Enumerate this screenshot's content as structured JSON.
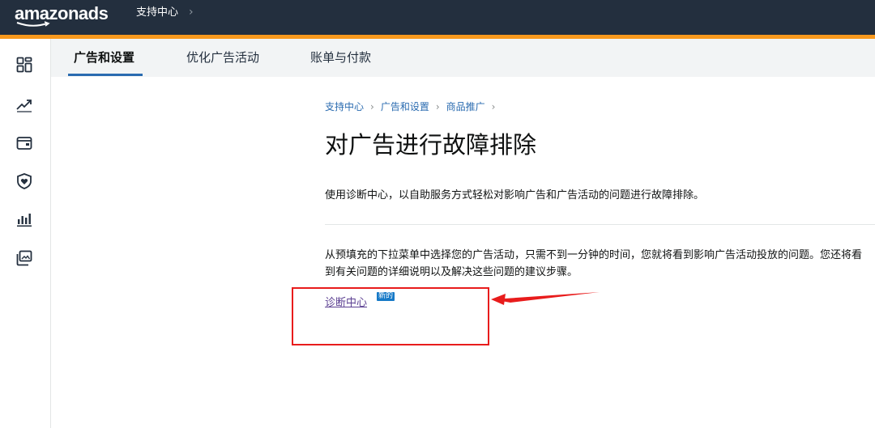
{
  "topbar": {
    "logo": "amazonads",
    "breadcrumb": "支持中心",
    "chevron": "›",
    "accent_color": "#f8991d",
    "background_color": "#232f3e"
  },
  "rail": {
    "icons": [
      "dashboard-icon",
      "trend-icon",
      "wallet-icon",
      "shield-heart-icon",
      "bar-chart-icon",
      "gallery-icon"
    ]
  },
  "tabs": [
    {
      "label": "广告和设置",
      "active": true
    },
    {
      "label": "优化广告活动",
      "active": false
    },
    {
      "label": "账单与付款",
      "active": false
    }
  ],
  "breadcrumb": {
    "items": [
      "支持中心",
      "广告和设置",
      "商品推广"
    ],
    "separator": "›"
  },
  "page": {
    "title": "对广告进行故障排除",
    "intro": "使用诊断中心，以自助服务方式轻松对影响广告和广告活动的问题进行故障排除。",
    "body": "从预填充的下拉菜单中选择您的广告活动，只需不到一分钟的时间，您就将看到影响广告活动投放的问题。您还将看到有关问题的详细说明以及解决这些问题的建议步骤。",
    "link": "诊断中心",
    "badge": "新的"
  },
  "annotation": {
    "color": "#e81c1c"
  }
}
